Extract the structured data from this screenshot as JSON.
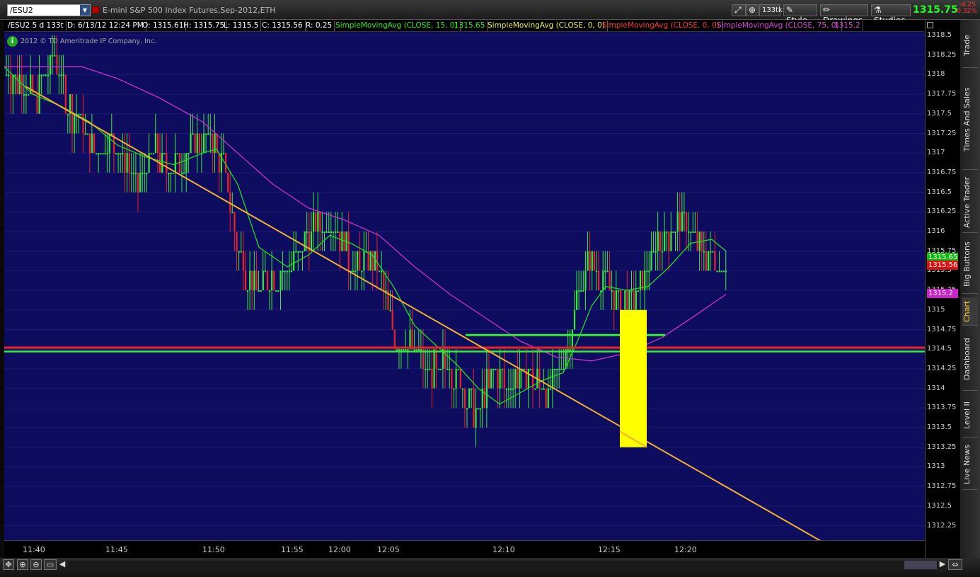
{
  "toolbar": {
    "symbol": "/ESU2",
    "description": "E-mini S&P 500 Index Futures,Sep-2012,ETH",
    "aggregation": "133tk",
    "style_label": "Style",
    "drawings_label": "Drawings",
    "studies_label": "Studies",
    "last_price": "1315.75",
    "change_abs": "-4.25",
    "change_pct": "-0.32%"
  },
  "study_header": {
    "symbol_period": "/ESU2 5 d 133t",
    "date": "D: 6/13/12 12:24 PM",
    "open": "O: 1315.61",
    "high": "H: 1315.75",
    "low": "L: 1315.5",
    "close": "C: 1315.56",
    "range": "R: 0.25",
    "sma15_label": "SimpleMovingAvg (CLOSE, 15, 0)",
    "sma15_value": "1315.65",
    "sma0a_label": "SimpleMovingAvg (CLOSE, 0, 0)",
    "sma0b_label": "SimpleMovingAvg (CLOSE, 0, 0)",
    "sma75_label": "SimpleMovingAvg (CLOSE, 75, 0)",
    "sma75_value": "1315.2"
  },
  "copyright": "2012 © TD Ameritrade IP Company, Inc.",
  "colors": {
    "chart_bg": "#0d0c5e",
    "up": "#33ee33",
    "down": "#ee2222",
    "sma15": "#22dd22",
    "sma75": "#cc33cc",
    "trendline": "#f0b030",
    "highlight": "#ffff00"
  },
  "side_tabs": [
    "Trade",
    "Times And Sales",
    "Active Trader",
    "Big Buttons",
    "Chart",
    "Dashboard",
    "Level II",
    "Live News"
  ],
  "price_badges": {
    "sma15": "1315.65",
    "close": "1315.56",
    "sma75": "1315.2"
  },
  "chart_data": {
    "type": "candlestick",
    "title": "E-mini S&P 500 Index Futures,Sep-2012,ETH",
    "xlabel": "",
    "ylabel": "",
    "ylim": [
      1312.0,
      1318.5
    ],
    "y_ticks": [
      "1318.5",
      "1318.25",
      "1318",
      "1317.75",
      "1317.5",
      "1317.25",
      "1317",
      "1316.75",
      "1316.5",
      "1316.25",
      "1316",
      "1315.75",
      "1315.5",
      "1315.25",
      "1315",
      "1314.75",
      "1314.5",
      "1314.25",
      "1314",
      "1313.75",
      "1313.5",
      "1313.25",
      "1313",
      "1312.75",
      "1312.5",
      "1312.25"
    ],
    "x_ticks": [
      "11:40",
      "11:45",
      "11:50",
      "11:55",
      "12:00",
      "12:05",
      "12:10",
      "12:15",
      "12:20"
    ],
    "series": [
      {
        "name": "SimpleMovingAvg (CLOSE, 15, 0)",
        "color": "#22dd22",
        "points": [
          [
            0,
            1318.1
          ],
          [
            40,
            1317.75
          ],
          [
            80,
            1317.6
          ],
          [
            120,
            1317.4
          ],
          [
            160,
            1317.1
          ],
          [
            200,
            1316.95
          ],
          [
            240,
            1316.85
          ],
          [
            280,
            1317.0
          ],
          [
            300,
            1317.05
          ],
          [
            330,
            1316.6
          ],
          [
            360,
            1315.8
          ],
          [
            400,
            1315.55
          ],
          [
            430,
            1315.7
          ],
          [
            460,
            1315.95
          ],
          [
            490,
            1315.85
          ],
          [
            520,
            1315.7
          ],
          [
            550,
            1315.3
          ],
          [
            580,
            1314.8
          ],
          [
            610,
            1314.55
          ],
          [
            640,
            1314.3
          ],
          [
            670,
            1314.0
          ],
          [
            700,
            1313.8
          ],
          [
            730,
            1313.95
          ],
          [
            760,
            1314.1
          ],
          [
            790,
            1314.2
          ],
          [
            810,
            1314.6
          ],
          [
            830,
            1315.05
          ],
          [
            850,
            1315.3
          ],
          [
            880,
            1315.25
          ],
          [
            910,
            1315.3
          ],
          [
            940,
            1315.55
          ],
          [
            970,
            1315.85
          ],
          [
            1000,
            1315.9
          ],
          [
            1020,
            1315.75
          ]
        ]
      },
      {
        "name": "SimpleMovingAvg (CLOSE, 75, 0)",
        "color": "#cc33cc",
        "points": [
          [
            0,
            1318.1
          ],
          [
            60,
            1318.1
          ],
          [
            110,
            1318.1
          ],
          [
            160,
            1317.95
          ],
          [
            220,
            1317.7
          ],
          [
            280,
            1317.4
          ],
          [
            330,
            1317.0
          ],
          [
            380,
            1316.6
          ],
          [
            430,
            1316.3
          ],
          [
            480,
            1316.15
          ],
          [
            530,
            1315.95
          ],
          [
            580,
            1315.55
          ],
          [
            630,
            1315.2
          ],
          [
            680,
            1314.9
          ],
          [
            730,
            1314.6
          ],
          [
            780,
            1314.4
          ],
          [
            830,
            1314.35
          ],
          [
            880,
            1314.45
          ],
          [
            930,
            1314.65
          ],
          [
            980,
            1314.95
          ],
          [
            1020,
            1315.2
          ]
        ]
      }
    ],
    "candles_summary": {
      "start": "11:39",
      "end": "12:24",
      "open_first": 1318.0,
      "last": {
        "open": 1315.61,
        "high": 1315.75,
        "low": 1315.5,
        "close": 1315.56
      }
    },
    "annotations": [
      {
        "type": "horizontal",
        "color": "#ee2222",
        "y": 1314.52
      },
      {
        "type": "horizontal",
        "color": "#33ee33",
        "y": 1314.47
      },
      {
        "type": "horizontal-segment",
        "color": "#33ee33",
        "y": 1314.68
      },
      {
        "type": "trendline",
        "color": "#f0b030"
      },
      {
        "type": "highlight-box",
        "color": "#ffff00",
        "y_top": 1315.0,
        "y_bottom": 1313.25
      }
    ]
  }
}
